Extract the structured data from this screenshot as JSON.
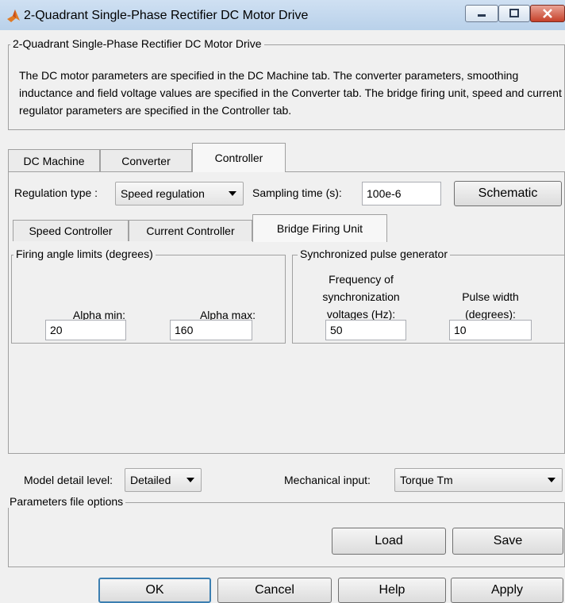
{
  "window": {
    "title": "2-Quadrant Single-Phase Rectifier DC Motor Drive",
    "minimize_icon": "minimize-icon",
    "maximize_icon": "maximize-icon",
    "close_icon": "close-icon",
    "app_icon": "matlab-icon"
  },
  "description_group": {
    "title": "2-Quadrant Single-Phase Rectifier DC Motor Drive",
    "text": "The DC motor parameters are specified in the DC Machine tab. The converter parameters, smoothing inductance and field voltage values are specified in the Converter tab. The bridge firing unit, speed and current regulator parameters are specified in the Controller tab."
  },
  "main_tabs": [
    {
      "label": "DC Machine",
      "active": false
    },
    {
      "label": "Converter",
      "active": false
    },
    {
      "label": "Controller",
      "active": true
    }
  ],
  "controller": {
    "regulation_label": "Regulation type :",
    "regulation_value": "Speed regulation",
    "sampling_label": "Sampling time (s):",
    "sampling_value": "100e-6",
    "schematic_button": "Schematic"
  },
  "sub_tabs": [
    {
      "label": "Speed Controller",
      "active": false
    },
    {
      "label": "Current Controller",
      "active": false
    },
    {
      "label": "Bridge Firing Unit",
      "active": true
    }
  ],
  "firing_limits": {
    "title": "Firing angle limits (degrees)",
    "alpha_min_label": "Alpha min:",
    "alpha_min_value": "20",
    "alpha_max_label": "Alpha max:",
    "alpha_max_value": "160"
  },
  "pulse_generator": {
    "title": "Synchronized pulse generator",
    "frequency_label_lines": [
      "Frequency of",
      "synchronization",
      "voltages (Hz):"
    ],
    "frequency_value": "50",
    "pulse_width_label_lines": [
      "Pulse width",
      "(degrees):"
    ],
    "pulse_width_value": "10"
  },
  "model": {
    "detail_label": "Model detail level:",
    "detail_value": "Detailed",
    "mechanical_label": "Mechanical input:",
    "mechanical_value": "Torque Tm"
  },
  "params_file": {
    "title": "Parameters file options",
    "load_button": "Load",
    "save_button": "Save"
  },
  "dialog_buttons": {
    "ok": "OK",
    "cancel": "Cancel",
    "help": "Help",
    "apply": "Apply"
  },
  "colors": {
    "title_bar": "#c4d7ec",
    "close_button": "#c6412a",
    "panel_bg": "#f0f0f0"
  }
}
